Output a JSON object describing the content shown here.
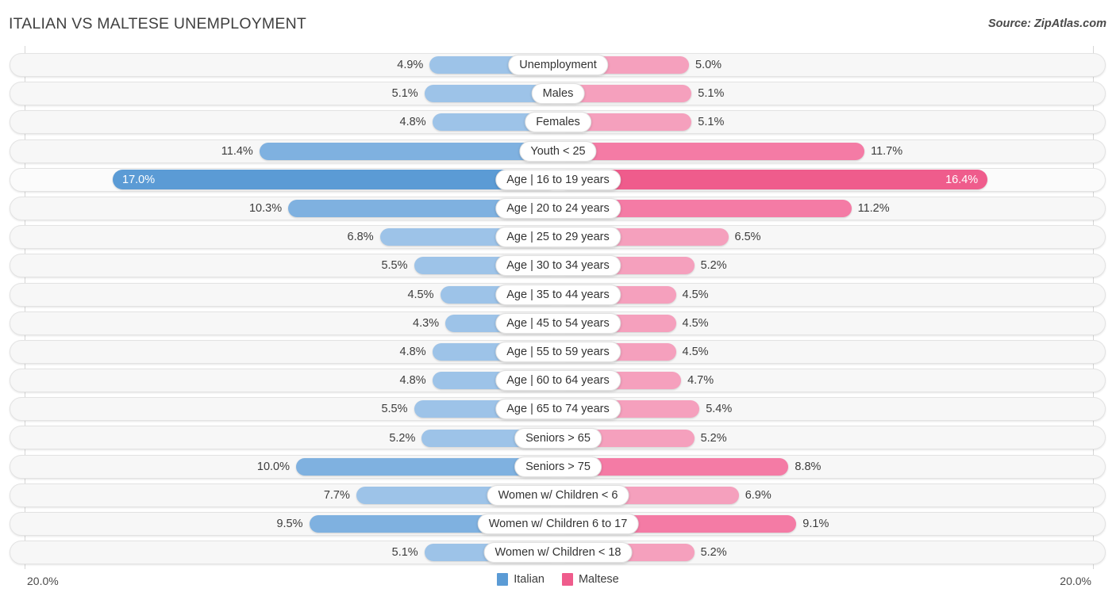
{
  "header": {
    "title": "ITALIAN VS MALTESE UNEMPLOYMENT",
    "source": "Source: ZipAtlas.com"
  },
  "legend": {
    "items": [
      {
        "label": "Italian",
        "color": "#5b9bd5"
      },
      {
        "label": "Maltese",
        "color": "#ef5c8c"
      }
    ]
  },
  "axis": {
    "left_max_label": "20.0%",
    "right_max_label": "20.0%",
    "max_value": 20.0
  },
  "chart_data": {
    "type": "bar",
    "orientation": "horizontal-diverging",
    "title": "ITALIAN VS MALTESE UNEMPLOYMENT",
    "xlabel": "",
    "ylabel": "",
    "xlim": [
      0,
      20
    ],
    "grid": true,
    "legend_position": "bottom-center",
    "categories": [
      "Unemployment",
      "Males",
      "Females",
      "Youth < 25",
      "Age | 16 to 19 years",
      "Age | 20 to 24 years",
      "Age | 25 to 29 years",
      "Age | 30 to 34 years",
      "Age | 35 to 44 years",
      "Age | 45 to 54 years",
      "Age | 55 to 59 years",
      "Age | 60 to 64 years",
      "Age | 65 to 74 years",
      "Seniors > 65",
      "Seniors > 75",
      "Women w/ Children < 6",
      "Women w/ Children 6 to 17",
      "Women w/ Children < 18"
    ],
    "series": [
      {
        "name": "Italian",
        "color": "#5b9bd5",
        "values": [
          4.9,
          5.1,
          4.8,
          11.4,
          17.0,
          10.3,
          6.8,
          5.5,
          4.5,
          4.3,
          4.8,
          4.8,
          5.5,
          5.2,
          10.0,
          7.7,
          9.5,
          5.1
        ]
      },
      {
        "name": "Maltese",
        "color": "#ef5c8c",
        "values": [
          5.0,
          5.1,
          5.1,
          11.7,
          16.4,
          11.2,
          6.5,
          5.2,
          4.5,
          4.5,
          4.5,
          4.7,
          5.4,
          5.2,
          8.8,
          6.9,
          9.1,
          5.2
        ]
      }
    ]
  },
  "rows": [
    {
      "label": "Unemployment",
      "left_value": "4.9%",
      "right_value": "5.0%",
      "left_pct": 4.9,
      "right_pct": 5.0,
      "tone": "light",
      "highlight": false
    },
    {
      "label": "Males",
      "left_value": "5.1%",
      "right_value": "5.1%",
      "left_pct": 5.1,
      "right_pct": 5.1,
      "tone": "light",
      "highlight": false
    },
    {
      "label": "Females",
      "left_value": "4.8%",
      "right_value": "5.1%",
      "left_pct": 4.8,
      "right_pct": 5.1,
      "tone": "light",
      "highlight": false
    },
    {
      "label": "Youth < 25",
      "left_value": "11.4%",
      "right_value": "11.7%",
      "left_pct": 11.4,
      "right_pct": 11.7,
      "tone": "mid",
      "highlight": false
    },
    {
      "label": "Age | 16 to 19 years",
      "left_value": "17.0%",
      "right_value": "16.4%",
      "left_pct": 17.0,
      "right_pct": 16.4,
      "tone": "strong",
      "highlight": true
    },
    {
      "label": "Age | 20 to 24 years",
      "left_value": "10.3%",
      "right_value": "11.2%",
      "left_pct": 10.3,
      "right_pct": 11.2,
      "tone": "mid",
      "highlight": false
    },
    {
      "label": "Age | 25 to 29 years",
      "left_value": "6.8%",
      "right_value": "6.5%",
      "left_pct": 6.8,
      "right_pct": 6.5,
      "tone": "light",
      "highlight": false
    },
    {
      "label": "Age | 30 to 34 years",
      "left_value": "5.5%",
      "right_value": "5.2%",
      "left_pct": 5.5,
      "right_pct": 5.2,
      "tone": "light",
      "highlight": false
    },
    {
      "label": "Age | 35 to 44 years",
      "left_value": "4.5%",
      "right_value": "4.5%",
      "left_pct": 4.5,
      "right_pct": 4.5,
      "tone": "light",
      "highlight": false
    },
    {
      "label": "Age | 45 to 54 years",
      "left_value": "4.3%",
      "right_value": "4.5%",
      "left_pct": 4.3,
      "right_pct": 4.5,
      "tone": "light",
      "highlight": false
    },
    {
      "label": "Age | 55 to 59 years",
      "left_value": "4.8%",
      "right_value": "4.5%",
      "left_pct": 4.8,
      "right_pct": 4.5,
      "tone": "light",
      "highlight": false
    },
    {
      "label": "Age | 60 to 64 years",
      "left_value": "4.8%",
      "right_value": "4.7%",
      "left_pct": 4.8,
      "right_pct": 4.7,
      "tone": "light",
      "highlight": false
    },
    {
      "label": "Age | 65 to 74 years",
      "left_value": "5.5%",
      "right_value": "5.4%",
      "left_pct": 5.5,
      "right_pct": 5.4,
      "tone": "light",
      "highlight": false
    },
    {
      "label": "Seniors > 65",
      "left_value": "5.2%",
      "right_value": "5.2%",
      "left_pct": 5.2,
      "right_pct": 5.2,
      "tone": "light",
      "highlight": false
    },
    {
      "label": "Seniors > 75",
      "left_value": "10.0%",
      "right_value": "8.8%",
      "left_pct": 10.0,
      "right_pct": 8.8,
      "tone": "mid",
      "highlight": false
    },
    {
      "label": "Women w/ Children < 6",
      "left_value": "7.7%",
      "right_value": "6.9%",
      "left_pct": 7.7,
      "right_pct": 6.9,
      "tone": "light",
      "highlight": false
    },
    {
      "label": "Women w/ Children 6 to 17",
      "left_value": "9.5%",
      "right_value": "9.1%",
      "left_pct": 9.5,
      "right_pct": 9.1,
      "tone": "mid",
      "highlight": false
    },
    {
      "label": "Women w/ Children < 18",
      "left_value": "5.1%",
      "right_value": "5.2%",
      "left_pct": 5.1,
      "right_pct": 5.2,
      "tone": "light",
      "highlight": false
    }
  ]
}
